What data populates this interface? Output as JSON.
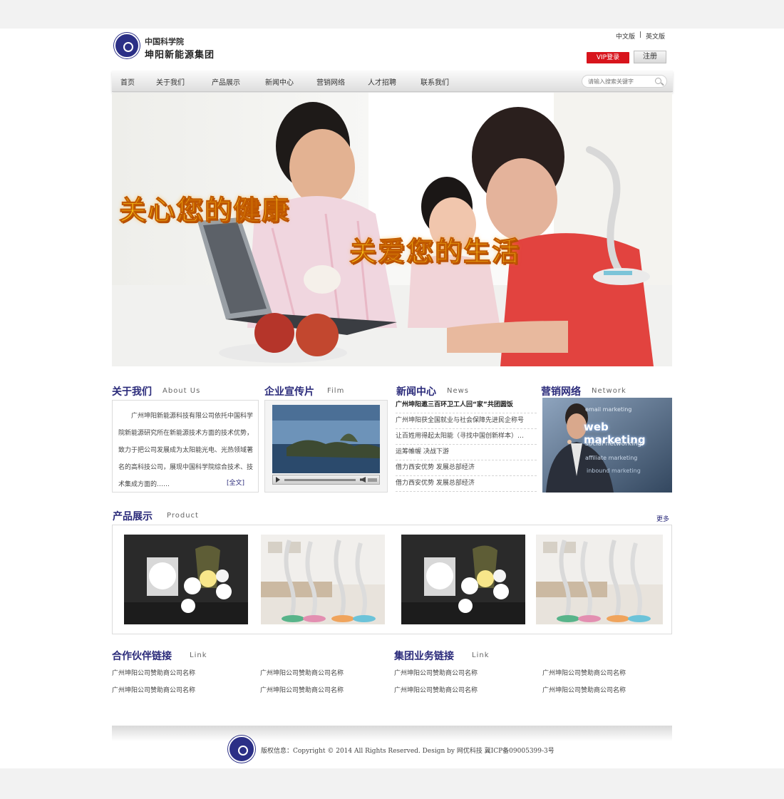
{
  "header": {
    "logo_line1": "中国科学院",
    "logo_line2": "坤阳新能源集团",
    "lang_cn": "中文版",
    "lang_sep": "|",
    "lang_en": "英文版",
    "vip_login": "VIP登录",
    "register": "注册"
  },
  "nav": {
    "items": [
      "首页",
      "关于我们",
      "产品展示",
      "新闻中心",
      "营销网络",
      "人才招聘",
      "联系我们"
    ],
    "search_placeholder": "请输入搜索关键字"
  },
  "banner": {
    "slogan1": "关心您的健康",
    "slogan2": "关爱您的生活"
  },
  "about": {
    "title": "关于我们",
    "subtitle": "About Us",
    "text": "广州坤阳新能源科技有限公司依托中国科学院新能源研究所在新能源技术方面的技术优势，致力于把公司发展成为太阳能光电、光热领域著名的高科技公司，展现中国科学院综合技术、技术集成方面的……",
    "more": "[全文]"
  },
  "film": {
    "title": "企业宣传片",
    "subtitle": "Film"
  },
  "news": {
    "title": "新闻中心",
    "subtitle": "News",
    "items": [
      "广州坤阳邀三百环卫工人回“家”共团圆饭",
      "广州坤阳获全国就业与社会保障先进民企称号",
      "让百姓用得起太阳能（寻找中国创新样本）…",
      "运筹帷幄 决战下游",
      "借力西安优势 发展总部经济",
      "借力西安优势 发展总部经济"
    ]
  },
  "network": {
    "title": "营销网络",
    "subtitle": "Network",
    "image_words": [
      "email marketing",
      "web marketing",
      "social networking",
      "affiliate marketing",
      "inbound marketing"
    ]
  },
  "products": {
    "title": "产品展示",
    "subtitle": "Product",
    "more": "更多"
  },
  "partner_links": {
    "title": "合作伙伴链接",
    "subtitle": "Link",
    "items": [
      "广州坤阳公司赞助商公司名称",
      "广州坤阳公司赞助商公司名称",
      "广州坤阳公司赞助商公司名称",
      "广州坤阳公司赞助商公司名称"
    ]
  },
  "group_links": {
    "title": "集团业务链接",
    "subtitle": "Link",
    "items": [
      "广州坤阳公司赞助商公司名称",
      "广州坤阳公司赞助商公司名称",
      "广州坤阳公司赞助商公司名称",
      "广州坤阳公司赞助商公司名称"
    ]
  },
  "footer": {
    "copyright": "版权信息：Copyright © 2014 All Rights Reserved. Design by 网优科技   冀ICP备09005399-3号"
  },
  "colors": {
    "accent": "#2a2a7a",
    "vip_red": "#d8141c",
    "slogan_yellow": "#ffd21f"
  }
}
